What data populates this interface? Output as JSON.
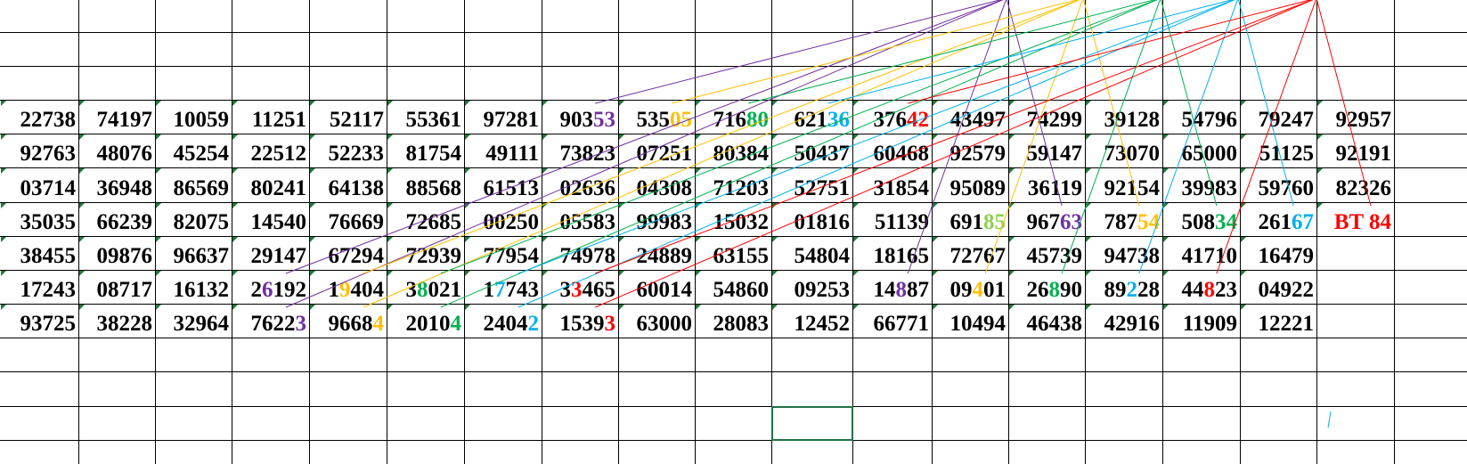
{
  "colors": {
    "grid": "#000000",
    "text": "#000000",
    "corner_marker": "#1e7a3c",
    "selection": "#217346",
    "purple": "#7030a0",
    "gold": "#ffc000",
    "green": "#00b050",
    "lightgreen": "#92d050",
    "cyan": "#00b0f0",
    "red": "#ff0000"
  },
  "sheet": {
    "rows": [
      [
        {
          "segments": [
            {
              "text": "22738"
            }
          ]
        },
        {
          "segments": [
            {
              "text": "74197"
            }
          ]
        },
        {
          "segments": [
            {
              "text": "10059"
            }
          ]
        },
        {
          "segments": [
            {
              "text": "11251"
            }
          ]
        },
        {
          "segments": [
            {
              "text": "52117"
            }
          ]
        },
        {
          "segments": [
            {
              "text": "55361"
            }
          ]
        },
        {
          "segments": [
            {
              "text": "97281"
            }
          ]
        },
        {
          "segments": [
            {
              "text": "903"
            },
            {
              "text": "53",
              "color": "purple"
            }
          ]
        },
        {
          "segments": [
            {
              "text": "535"
            },
            {
              "text": "05",
              "color": "gold"
            }
          ]
        },
        {
          "segments": [
            {
              "text": "716"
            },
            {
              "text": "80",
              "color": "green"
            }
          ]
        },
        {
          "segments": [
            {
              "text": "621"
            },
            {
              "text": "36",
              "color": "cyan"
            }
          ]
        },
        {
          "segments": [
            {
              "text": "376"
            },
            {
              "text": "42",
              "color": "red"
            }
          ]
        },
        {
          "segments": [
            {
              "text": "43497"
            }
          ]
        },
        {
          "segments": [
            {
              "text": "74299"
            }
          ]
        },
        {
          "segments": [
            {
              "text": "39128"
            }
          ]
        },
        {
          "segments": [
            {
              "text": "54796"
            }
          ]
        },
        {
          "segments": [
            {
              "text": "79247"
            }
          ]
        },
        {
          "segments": [
            {
              "text": "92957"
            }
          ]
        }
      ],
      [
        {
          "segments": [
            {
              "text": "92763"
            }
          ]
        },
        {
          "segments": [
            {
              "text": "48076"
            }
          ]
        },
        {
          "segments": [
            {
              "text": "45254"
            }
          ]
        },
        {
          "segments": [
            {
              "text": "22512"
            }
          ]
        },
        {
          "segments": [
            {
              "text": "52233"
            }
          ]
        },
        {
          "segments": [
            {
              "text": "81754"
            }
          ]
        },
        {
          "segments": [
            {
              "text": "49111"
            }
          ]
        },
        {
          "segments": [
            {
              "text": "73823"
            }
          ]
        },
        {
          "segments": [
            {
              "text": "07251"
            }
          ]
        },
        {
          "segments": [
            {
              "text": "80384"
            }
          ]
        },
        {
          "segments": [
            {
              "text": "50437"
            }
          ]
        },
        {
          "segments": [
            {
              "text": "60468"
            }
          ]
        },
        {
          "segments": [
            {
              "text": "92579"
            }
          ]
        },
        {
          "segments": [
            {
              "text": "59147"
            }
          ]
        },
        {
          "segments": [
            {
              "text": "73070"
            }
          ]
        },
        {
          "segments": [
            {
              "text": "65000"
            }
          ]
        },
        {
          "segments": [
            {
              "text": "51125"
            }
          ]
        },
        {
          "segments": [
            {
              "text": "92191"
            }
          ]
        }
      ],
      [
        {
          "segments": [
            {
              "text": "03714"
            }
          ]
        },
        {
          "segments": [
            {
              "text": "36948"
            }
          ]
        },
        {
          "segments": [
            {
              "text": "86569"
            }
          ]
        },
        {
          "segments": [
            {
              "text": "80241"
            }
          ]
        },
        {
          "segments": [
            {
              "text": "64138"
            }
          ]
        },
        {
          "segments": [
            {
              "text": "88568"
            }
          ]
        },
        {
          "segments": [
            {
              "text": "61513"
            }
          ]
        },
        {
          "segments": [
            {
              "text": "02636"
            }
          ]
        },
        {
          "segments": [
            {
              "text": "04308"
            }
          ]
        },
        {
          "segments": [
            {
              "text": "71203"
            }
          ]
        },
        {
          "segments": [
            {
              "text": "52751"
            }
          ]
        },
        {
          "segments": [
            {
              "text": "31854"
            }
          ]
        },
        {
          "segments": [
            {
              "text": "95089"
            }
          ]
        },
        {
          "segments": [
            {
              "text": "36119"
            }
          ]
        },
        {
          "segments": [
            {
              "text": "92154"
            }
          ]
        },
        {
          "segments": [
            {
              "text": "39983"
            }
          ]
        },
        {
          "segments": [
            {
              "text": "59760"
            }
          ]
        },
        {
          "segments": [
            {
              "text": "82326"
            }
          ]
        }
      ],
      [
        {
          "segments": [
            {
              "text": "35035"
            }
          ]
        },
        {
          "segments": [
            {
              "text": "66239"
            }
          ]
        },
        {
          "segments": [
            {
              "text": "82075"
            }
          ]
        },
        {
          "segments": [
            {
              "text": "14540"
            }
          ]
        },
        {
          "segments": [
            {
              "text": "76669"
            }
          ]
        },
        {
          "segments": [
            {
              "text": "72685"
            }
          ]
        },
        {
          "segments": [
            {
              "text": "00250"
            }
          ]
        },
        {
          "segments": [
            {
              "text": "05583"
            }
          ]
        },
        {
          "segments": [
            {
              "text": "99983"
            }
          ]
        },
        {
          "segments": [
            {
              "text": "15032"
            }
          ]
        },
        {
          "segments": [
            {
              "text": "01816"
            }
          ]
        },
        {
          "segments": [
            {
              "text": "51139"
            }
          ]
        },
        {
          "segments": [
            {
              "text": "691"
            },
            {
              "text": "85",
              "color": "lightgreen"
            }
          ]
        },
        {
          "segments": [
            {
              "text": "967"
            },
            {
              "text": "63",
              "color": "purple"
            }
          ]
        },
        {
          "segments": [
            {
              "text": "787"
            },
            {
              "text": "54",
              "color": "gold"
            }
          ]
        },
        {
          "segments": [
            {
              "text": "508"
            },
            {
              "text": "34",
              "color": "green"
            }
          ]
        },
        {
          "segments": [
            {
              "text": "261"
            },
            {
              "text": "67",
              "color": "cyan"
            }
          ]
        },
        {
          "segments": [
            {
              "text": "BT 84",
              "color": "red"
            }
          ]
        }
      ],
      [
        {
          "segments": [
            {
              "text": "38455"
            }
          ]
        },
        {
          "segments": [
            {
              "text": "09876"
            }
          ]
        },
        {
          "segments": [
            {
              "text": "96637"
            }
          ]
        },
        {
          "segments": [
            {
              "text": "29147"
            }
          ]
        },
        {
          "segments": [
            {
              "text": "67294"
            }
          ]
        },
        {
          "segments": [
            {
              "text": "72939"
            }
          ]
        },
        {
          "segments": [
            {
              "text": "77954"
            }
          ]
        },
        {
          "segments": [
            {
              "text": "74978"
            }
          ]
        },
        {
          "segments": [
            {
              "text": "24889"
            }
          ]
        },
        {
          "segments": [
            {
              "text": "63155"
            }
          ]
        },
        {
          "segments": [
            {
              "text": "54804"
            }
          ]
        },
        {
          "segments": [
            {
              "text": "18165"
            }
          ]
        },
        {
          "segments": [
            {
              "text": "72767"
            }
          ]
        },
        {
          "segments": [
            {
              "text": "45739"
            }
          ]
        },
        {
          "segments": [
            {
              "text": "94738"
            }
          ]
        },
        {
          "segments": [
            {
              "text": "41710"
            }
          ]
        },
        {
          "segments": [
            {
              "text": "16479"
            }
          ]
        },
        {
          "segments": []
        }
      ],
      [
        {
          "segments": [
            {
              "text": "17243"
            }
          ]
        },
        {
          "segments": [
            {
              "text": "08717"
            }
          ]
        },
        {
          "segments": [
            {
              "text": "16132"
            }
          ]
        },
        {
          "segments": [
            {
              "text": "2"
            },
            {
              "text": "6",
              "color": "purple"
            },
            {
              "text": "192"
            }
          ]
        },
        {
          "segments": [
            {
              "text": "1"
            },
            {
              "text": "9",
              "color": "gold"
            },
            {
              "text": "404"
            }
          ]
        },
        {
          "segments": [
            {
              "text": "3"
            },
            {
              "text": "8",
              "color": "green"
            },
            {
              "text": "021"
            }
          ]
        },
        {
          "segments": [
            {
              "text": "1"
            },
            {
              "text": "7",
              "color": "cyan"
            },
            {
              "text": "743"
            }
          ]
        },
        {
          "segments": [
            {
              "text": "3"
            },
            {
              "text": "3",
              "color": "red"
            },
            {
              "text": "465"
            }
          ]
        },
        {
          "segments": [
            {
              "text": "60014"
            }
          ]
        },
        {
          "segments": [
            {
              "text": "54860"
            }
          ]
        },
        {
          "segments": [
            {
              "text": "09253"
            }
          ]
        },
        {
          "segments": [
            {
              "text": "14"
            },
            {
              "text": "8",
              "color": "purple"
            },
            {
              "text": "87"
            }
          ]
        },
        {
          "segments": [
            {
              "text": "09"
            },
            {
              "text": "4",
              "color": "gold"
            },
            {
              "text": "01"
            }
          ]
        },
        {
          "segments": [
            {
              "text": "26"
            },
            {
              "text": "8",
              "color": "green"
            },
            {
              "text": "90"
            }
          ]
        },
        {
          "segments": [
            {
              "text": "89"
            },
            {
              "text": "2",
              "color": "cyan"
            },
            {
              "text": "28"
            }
          ]
        },
        {
          "segments": [
            {
              "text": "44"
            },
            {
              "text": "8",
              "color": "red"
            },
            {
              "text": "23"
            }
          ]
        },
        {
          "segments": [
            {
              "text": "04922"
            }
          ]
        },
        {
          "segments": []
        }
      ],
      [
        {
          "segments": [
            {
              "text": "93725"
            }
          ]
        },
        {
          "segments": [
            {
              "text": "38228"
            }
          ]
        },
        {
          "segments": [
            {
              "text": "32964"
            }
          ]
        },
        {
          "segments": [
            {
              "text": "7622"
            },
            {
              "text": "3",
              "color": "purple"
            }
          ]
        },
        {
          "segments": [
            {
              "text": "9668"
            },
            {
              "text": "4",
              "color": "gold"
            }
          ]
        },
        {
          "segments": [
            {
              "text": "2010"
            },
            {
              "text": "4",
              "color": "green"
            }
          ]
        },
        {
          "segments": [
            {
              "text": "2404"
            },
            {
              "text": "2",
              "color": "cyan"
            }
          ]
        },
        {
          "segments": [
            {
              "text": "1539"
            },
            {
              "text": "3",
              "color": "red"
            }
          ]
        },
        {
          "segments": [
            {
              "text": "63000"
            }
          ]
        },
        {
          "segments": [
            {
              "text": "28083"
            }
          ]
        },
        {
          "segments": [
            {
              "text": "12452"
            }
          ]
        },
        {
          "segments": [
            {
              "text": "66771"
            }
          ]
        },
        {
          "segments": [
            {
              "text": "10494"
            }
          ]
        },
        {
          "segments": [
            {
              "text": "46438"
            }
          ]
        },
        {
          "segments": [
            {
              "text": "42916"
            }
          ]
        },
        {
          "segments": [
            {
              "text": "11909"
            }
          ]
        },
        {
          "segments": [
            {
              "text": "12221"
            }
          ]
        },
        {
          "segments": []
        }
      ]
    ],
    "connectors": [
      {
        "color": "purple",
        "targets": [
          "0.7",
          "5.3",
          "6.3",
          "5.11",
          "3.13"
        ]
      },
      {
        "color": "gold",
        "targets": [
          "0.8",
          "5.4",
          "6.4",
          "5.12",
          "3.14"
        ]
      },
      {
        "color": "green",
        "targets": [
          "0.9",
          "5.5",
          "6.5",
          "5.13",
          "3.15"
        ]
      },
      {
        "color": "cyan",
        "targets": [
          "0.10",
          "5.6",
          "6.6",
          "5.14",
          "3.16"
        ]
      },
      {
        "color": "red",
        "targets": [
          "0.11",
          "5.7",
          "6.7",
          "5.15",
          "3.17"
        ]
      }
    ]
  }
}
